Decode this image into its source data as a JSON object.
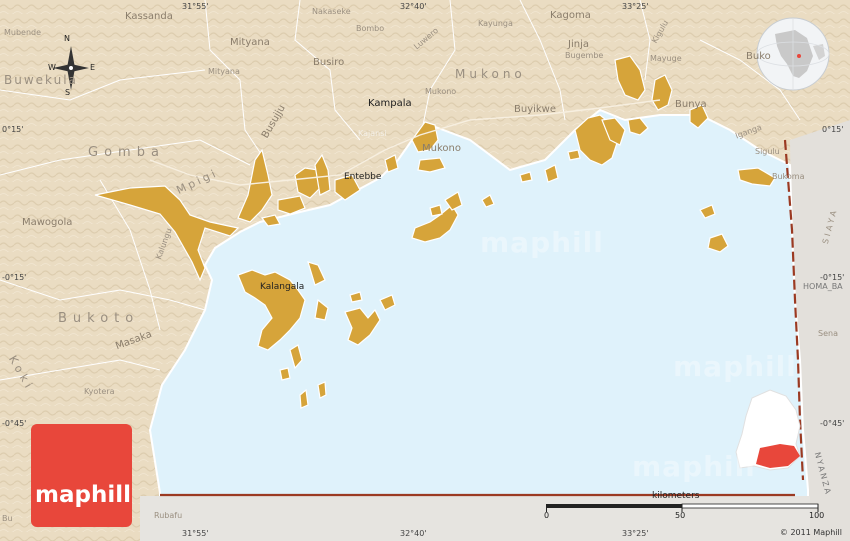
{
  "map": {
    "compass": {
      "n": "N",
      "s": "S",
      "e": "E",
      "w": "W"
    },
    "labels": {
      "mubende": "Mubende",
      "kassanda": "Kassanda",
      "nakaseke": "Nakaseke",
      "bombo": "Bombo",
      "kayunga": "Kayunga",
      "kagoma": "Kagoma",
      "kigulu": "Kigulu",
      "buwekula": "Buwekula",
      "mityana1": "Mityana",
      "mityana2": "Mityana",
      "busiro": "Busiro",
      "luwero": "Luwero",
      "mukono1": "Mukono",
      "mukono2": "Mukono",
      "mukono3": "Mukono",
      "jinja": "Jinja",
      "bugembe": "Bugembe",
      "mayuge": "Mayuge",
      "buko": "Buko",
      "busujju": "Busujju",
      "kampala": "Kampala",
      "kajansi": "Kajansi",
      "buyikwe": "Buyikwe",
      "bunya": "Bunya",
      "iganga": "Iganga",
      "gomba": "Gomba",
      "mpigi": "Mpigi",
      "entebbe": "Entebbe",
      "sigulu": "Sigulu",
      "bukoma": "Bukoma",
      "siaya": "SIAYA",
      "mawogola": "Mawogola",
      "kalungu": "Kalungu",
      "kalangala": "Kalangala",
      "homabay": "HOMA_BA",
      "sena": "Sena",
      "bukoto": "Bukoto",
      "masaka": "Masaka",
      "koki": "Koki",
      "kyotera": "Kyotera",
      "nyanza": "NYANZA",
      "rubafu": "Rubafu",
      "bukanga": "Bu"
    },
    "coords": {
      "lon1_top": "31°55'",
      "lon2_top": "32°40'",
      "lon3_top": "33°25'",
      "lon1_bot": "31°55'",
      "lon2_bot": "32°40'",
      "lon3_bot": "33°25'",
      "lat1_left": "0°15'",
      "lat2_left": "-0°15'",
      "lat3_left": "-0°45'",
      "lat1_right": "0°15'",
      "lat2_right": "-0°15'",
      "lat3_right": "-0°45'"
    },
    "watermarks": [
      "maphill",
      "maphill",
      "maphill"
    ],
    "logo": "maphill",
    "scale": {
      "title": "kilometers",
      "t0": "0",
      "t1": "50",
      "t2": "100"
    },
    "copyright": "© 2011 Maphill",
    "colors": {
      "land": "#e9dcc3",
      "water": "#dff2fb",
      "islands": "#d6a43a",
      "logo": "#e8473b",
      "accent": "#9b3a22"
    }
  }
}
